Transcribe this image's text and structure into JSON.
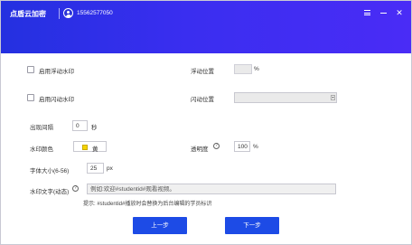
{
  "titlebar": {
    "app_title": "点盾云加密",
    "phone": "15562577050",
    "menu_icon": "menu-icon",
    "minimize_icon": "minimize-icon",
    "close_icon": "close-icon",
    "close_glyph": "✕"
  },
  "form": {
    "float_watermark_label": "启用浮动水印",
    "float_position_label": "浮动位置",
    "float_position_value": "",
    "float_position_unit": "%",
    "flash_watermark_label": "启用闪动水印",
    "flash_position_label": "闪动位置",
    "flash_position_value": "",
    "interval_label": "出现间隔",
    "interval_value": "0",
    "interval_unit": "秒",
    "color_label": "水印颜色",
    "color_value": "黄",
    "color_hex": "#f5d400",
    "opacity_label": "透明度",
    "opacity_value": "100",
    "opacity_unit": "%",
    "font_size_label": "字体大小(6-56)",
    "font_size_value": "25",
    "font_size_unit": "px",
    "watermark_text_label": "水印文字(动态)",
    "watermark_text_placeholder": "例如:欢迎#studentid#观看视频。",
    "hint": "提示: #studentid#播放时会替换为后台编辑的学员标识"
  },
  "buttons": {
    "prev_label": "上一步",
    "next_label": "下一步"
  },
  "colors": {
    "titlebar_start": "#2430e0",
    "titlebar_end": "#4a2cf6",
    "button": "#1d4be6"
  }
}
